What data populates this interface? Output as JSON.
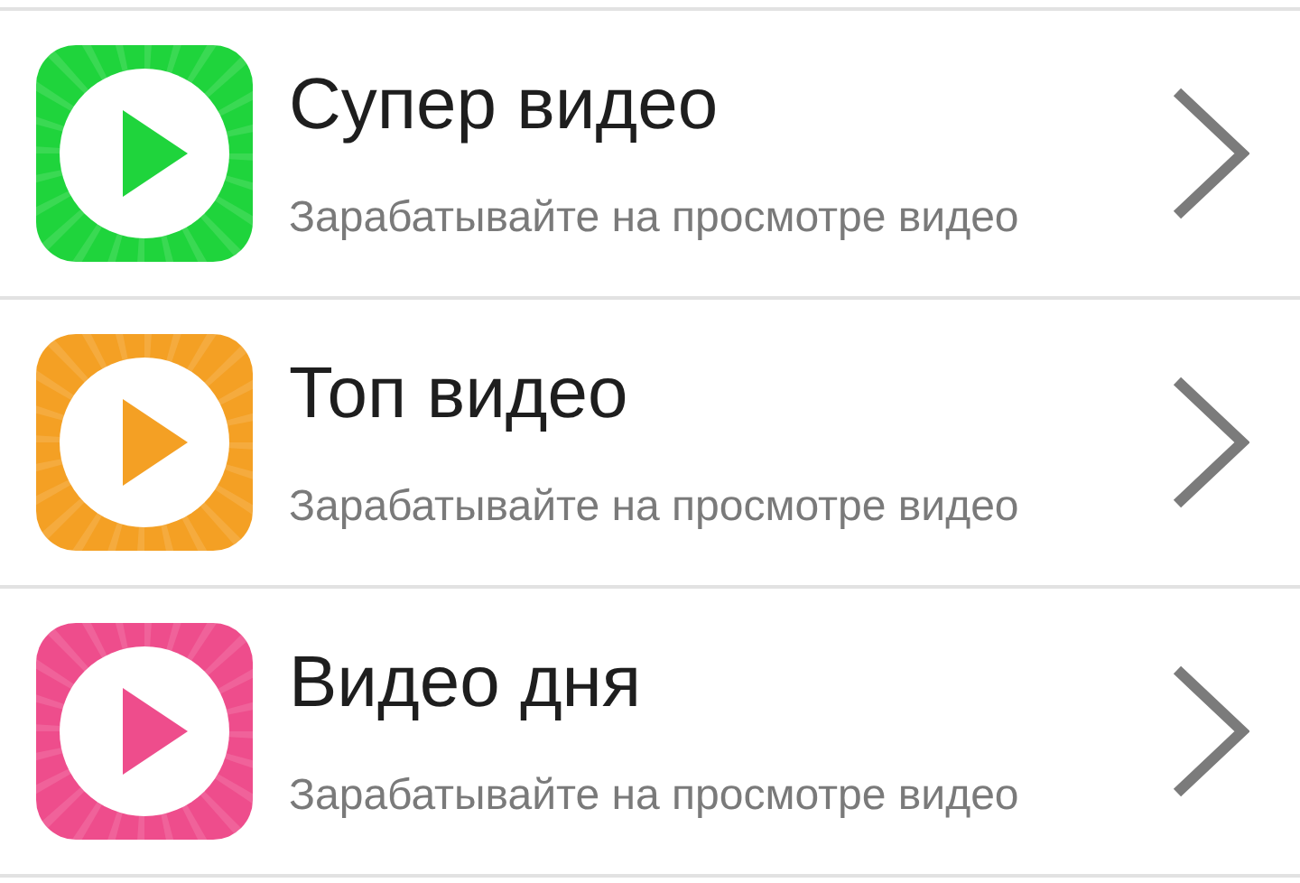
{
  "items": [
    {
      "title": "Супер видео",
      "subtitle": "Зарабатывайте на просмотре видео",
      "color": "#1fd43c"
    },
    {
      "title": "Топ видео",
      "subtitle": "Зарабатывайте на просмотре видео",
      "color": "#f4a024"
    },
    {
      "title": "Видео дня",
      "subtitle": "Зарабатывайте на просмотре видео",
      "color": "#ee4d8c"
    }
  ]
}
